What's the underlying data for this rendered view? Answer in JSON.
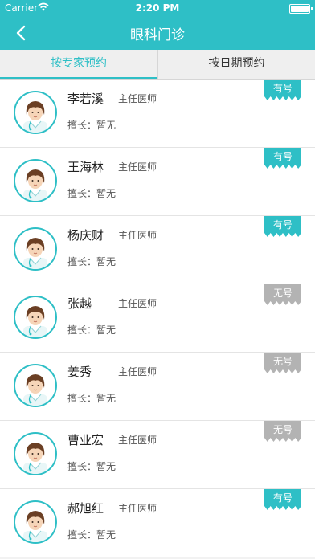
{
  "status_bar": {
    "carrier": "Carrier",
    "time": "2:20 PM"
  },
  "header": {
    "title": "眼科门诊"
  },
  "tabs": [
    {
      "label": "按专家预约",
      "active": true
    },
    {
      "label": "按日期预约",
      "active": false
    }
  ],
  "colors": {
    "accent": "#2ebfc6",
    "unavailable": "#b3b3b3"
  },
  "doctors": [
    {
      "name": "李若溪",
      "title": "主任医师",
      "specialty": "擅长：暂无",
      "status": "有号",
      "available": true
    },
    {
      "name": "王海林",
      "title": "主任医师",
      "specialty": "擅长：暂无",
      "status": "有号",
      "available": true
    },
    {
      "name": "杨庆财",
      "title": "主任医师",
      "specialty": "擅长：暂无",
      "status": "有号",
      "available": true
    },
    {
      "name": "张越",
      "title": "主任医师",
      "specialty": "擅长：暂无",
      "status": "无号",
      "available": false
    },
    {
      "name": "姜秀",
      "title": "主任医师",
      "specialty": "擅长：暂无",
      "status": "无号",
      "available": false
    },
    {
      "name": "曹业宏",
      "title": "主任医师",
      "specialty": "擅长：暂无",
      "status": "无号",
      "available": false
    },
    {
      "name": "郝旭红",
      "title": "主任医师",
      "specialty": "擅长：暂无",
      "status": "有号",
      "available": true
    }
  ]
}
